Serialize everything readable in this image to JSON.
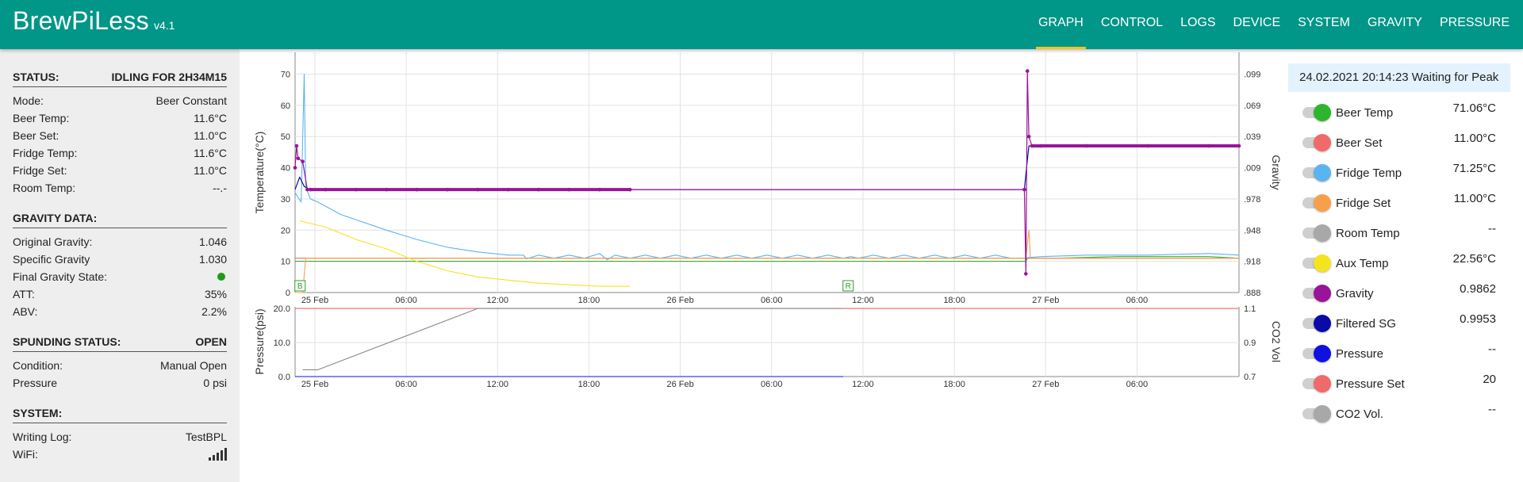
{
  "app": {
    "title": "BrewPiLess",
    "version": "v4.1"
  },
  "nav": [
    {
      "label": "GRAPH",
      "active": true
    },
    {
      "label": "CONTROL"
    },
    {
      "label": "LOGS"
    },
    {
      "label": "DEVICE"
    },
    {
      "label": "SYSTEM"
    },
    {
      "label": "GRAVITY"
    },
    {
      "label": "PRESSURE"
    }
  ],
  "sidebar": {
    "status": {
      "label": "STATUS:",
      "value": "IDLING FOR 2H34M15"
    },
    "status_rows": [
      {
        "label": "Mode:",
        "value": "Beer Constant"
      },
      {
        "label": "Beer Temp:",
        "value": "11.6°C"
      },
      {
        "label": "Beer Set:",
        "value": "11.0°C"
      },
      {
        "label": "Fridge Temp:",
        "value": "11.6°C"
      },
      {
        "label": "Fridge Set:",
        "value": "11.0°C"
      },
      {
        "label": "Room Temp:",
        "value": "--.-"
      }
    ],
    "gravity": {
      "label": "GRAVITY DATA:"
    },
    "gravity_rows": [
      {
        "label": "Original Gravity:",
        "value": "1.046"
      },
      {
        "label": "Specific Gravity",
        "value": "1.030"
      },
      {
        "label": "Final Gravity State:",
        "value": ""
      },
      {
        "label": "ATT:",
        "value": "35%"
      },
      {
        "label": "ABV:",
        "value": "2.2%"
      }
    ],
    "spunding": {
      "label": "SPUNDING STATUS:",
      "value": "OPEN"
    },
    "spunding_rows": [
      {
        "label": "Condition:",
        "value": "Manual Open"
      },
      {
        "label": "Pressure",
        "value": "0 psi"
      }
    ],
    "system": {
      "label": "SYSTEM:"
    },
    "system_rows": [
      {
        "label": "Writing Log:",
        "value": "TestBPL"
      },
      {
        "label": "WiFi:",
        "value": ""
      }
    ]
  },
  "panel": {
    "datetime": "24.02.2021 20:14:23 Waiting for Peak",
    "legend": [
      {
        "name": "Beer Temp",
        "value": "71.06°C",
        "color": "#2db52d"
      },
      {
        "name": "Beer Set",
        "value": "11.00°C",
        "color": "#f06a6a"
      },
      {
        "name": "Fridge Temp",
        "value": "71.25°C",
        "color": "#5ab4f2"
      },
      {
        "name": "Fridge Set",
        "value": "11.00°C",
        "color": "#f7a04b"
      },
      {
        "name": "Room Temp",
        "value": "--",
        "color": "#a8a8a8"
      },
      {
        "name": "Aux Temp",
        "value": "22.56°C",
        "color": "#f4e41e"
      },
      {
        "name": "Gravity",
        "value": "0.9862",
        "color": "#991499"
      },
      {
        "name": "Filtered SG",
        "value": "0.9953",
        "color": "#0a0aa8"
      },
      {
        "name": "Pressure",
        "value": "--",
        "color": "#1010e0"
      },
      {
        "name": "Pressure Set",
        "value": "20",
        "color": "#f06a6a"
      },
      {
        "name": "CO2 Vol.",
        "value": "--",
        "color": "#a8a8a8"
      }
    ]
  },
  "chart_data": [
    {
      "type": "line",
      "ylabel": "Temperature(°C)",
      "y2label": "Gravity",
      "x_tick_labels": [
        "25 Feb",
        "06:00",
        "12:00",
        "18:00",
        "26 Feb",
        "06:00",
        "12:00",
        "18:00",
        "27 Feb",
        "06:00"
      ],
      "y_ticks": [
        "0",
        "10",
        "20",
        "30",
        "40",
        "50",
        "60",
        "70"
      ],
      "y2_ticks": [
        ".888",
        ".918",
        ".948",
        ".978",
        ".009",
        ".039",
        ".069",
        ".099"
      ],
      "ylim": [
        0,
        77
      ],
      "grid": true,
      "annotations": [
        {
          "text": "B",
          "x_hours": 0.3
        },
        {
          "text": "R",
          "x_hours": 36.3
        }
      ],
      "series": [
        {
          "name": "Beer Temp",
          "color": "#2db52d",
          "points": [
            [
              0,
              10
            ],
            [
              0.3,
              10
            ],
            [
              2,
              10
            ],
            [
              4,
              10
            ],
            [
              8,
              10
            ],
            [
              12,
              10
            ],
            [
              16,
              10
            ],
            [
              22,
              10
            ],
            [
              24,
              10
            ],
            [
              28,
              10
            ],
            [
              36,
              10
            ],
            [
              40,
              10
            ],
            [
              48,
              10
            ],
            [
              48.1,
              11
            ],
            [
              50,
              11
            ],
            [
              54,
              11.5
            ],
            [
              60,
              11.5
            ],
            [
              62,
              11
            ]
          ]
        },
        {
          "name": "Beer Set",
          "color": "#f06a6a",
          "points": [
            [
              0,
              11
            ],
            [
              30,
              11
            ],
            [
              36,
              11
            ],
            [
              62,
              11
            ]
          ]
        },
        {
          "name": "Fridge Temp",
          "color": "#5ab4f2",
          "points": [
            [
              0,
              32
            ],
            [
              0.4,
              29
            ],
            [
              0.6,
              70
            ],
            [
              0.7,
              34
            ],
            [
              1,
              30
            ],
            [
              1.5,
              29
            ],
            [
              3,
              25
            ],
            [
              6,
              20
            ],
            [
              8,
              17
            ],
            [
              10,
              14.5
            ],
            [
              12,
              13
            ],
            [
              14,
              12
            ],
            [
              15,
              12
            ],
            [
              15.2,
              10.8
            ],
            [
              16,
              12
            ],
            [
              17,
              11
            ],
            [
              18,
              12
            ],
            [
              19,
              11
            ],
            [
              20,
              12.5
            ],
            [
              20.5,
              10.5
            ],
            [
              21,
              12
            ],
            [
              22,
              11
            ],
            [
              23,
              12
            ],
            [
              24,
              11
            ],
            [
              25,
              12
            ],
            [
              26,
              11
            ],
            [
              27,
              12
            ],
            [
              28,
              11
            ],
            [
              29,
              12
            ],
            [
              30,
              11
            ],
            [
              31,
              12
            ],
            [
              32,
              11
            ],
            [
              33,
              12
            ],
            [
              34,
              11
            ],
            [
              35,
              12
            ],
            [
              36,
              11
            ],
            [
              36.5,
              11.5
            ],
            [
              37,
              11
            ],
            [
              38,
              12
            ],
            [
              39,
              11
            ],
            [
              40,
              12
            ],
            [
              41,
              11
            ],
            [
              42,
              12
            ],
            [
              43,
              11
            ],
            [
              44,
              12
            ],
            [
              45,
              11
            ],
            [
              46,
              12
            ],
            [
              47,
              11
            ],
            [
              48,
              11
            ],
            [
              48.15,
              11.2
            ],
            [
              49,
              11.5
            ],
            [
              52,
              12
            ],
            [
              56,
              12
            ],
            [
              60,
              12.5
            ],
            [
              62,
              12
            ]
          ]
        },
        {
          "name": "Fridge Set",
          "color": "#f7a04b",
          "points": [
            [
              0,
              0
            ],
            [
              0.5,
              0
            ],
            [
              0.7,
              11
            ],
            [
              30,
              11
            ],
            [
              36,
              11
            ],
            [
              48,
              11
            ],
            [
              48.2,
              20
            ],
            [
              48.3,
              11
            ],
            [
              62,
              11
            ]
          ]
        },
        {
          "name": "Aux Temp",
          "color": "#f4e41e",
          "points": [
            [
              0.3,
              23
            ],
            [
              2,
              21
            ],
            [
              4,
              17
            ],
            [
              6,
              14
            ],
            [
              8,
              10
            ],
            [
              10,
              7
            ],
            [
              12,
              5
            ],
            [
              14,
              4
            ],
            [
              16,
              3
            ],
            [
              18,
              2.5
            ],
            [
              20,
              2
            ],
            [
              22,
              2
            ]
          ]
        },
        {
          "name": "Filtered SG",
          "color": "#0a0aa8",
          "points": [
            [
              0,
              33
            ],
            [
              0.3,
              37
            ],
            [
              0.6,
              34
            ],
            [
              1,
              33
            ],
            [
              4,
              33
            ],
            [
              8,
              33
            ],
            [
              12,
              33
            ],
            [
              16,
              33
            ],
            [
              20,
              33
            ],
            [
              24,
              33
            ],
            [
              30,
              33
            ],
            [
              36,
              33
            ],
            [
              40,
              33
            ],
            [
              44,
              33
            ],
            [
              47.9,
              33
            ],
            [
              48,
              38
            ],
            [
              48.2,
              47
            ],
            [
              49,
              47
            ],
            [
              52,
              47
            ],
            [
              56,
              47
            ],
            [
              60,
              47
            ],
            [
              62,
              47
            ]
          ]
        },
        {
          "name": "Gravity",
          "color": "#991499",
          "points": [
            [
              0,
              40
            ],
            [
              0.1,
              47
            ],
            [
              0.2,
              43
            ],
            [
              0.5,
              42
            ],
            [
              0.8,
              33
            ],
            [
              1,
              33
            ],
            [
              2,
              33
            ],
            [
              4,
              33
            ],
            [
              6,
              33
            ],
            [
              8,
              33
            ],
            [
              10,
              33
            ],
            [
              12,
              33
            ],
            [
              14,
              33
            ],
            [
              16,
              33
            ],
            [
              18,
              33
            ],
            [
              20,
              33
            ],
            [
              22,
              33
            ],
            [
              47.9,
              33
            ],
            [
              48,
              6
            ],
            [
              48.1,
              71
            ],
            [
              48.2,
              50
            ],
            [
              48.4,
              47
            ],
            [
              49,
              47
            ],
            [
              52,
              47
            ],
            [
              56,
              47
            ],
            [
              60,
              47
            ],
            [
              62,
              47
            ]
          ]
        }
      ]
    },
    {
      "type": "line",
      "ylabel": "Pressure(psi)",
      "y2label": "CO2 Vol",
      "x_tick_labels": [
        "25 Feb",
        "06:00",
        "12:00",
        "18:00",
        "26 Feb",
        "06:00",
        "12:00",
        "18:00",
        "27 Feb",
        "06:00"
      ],
      "y_ticks": [
        "0.0",
        "10.0",
        "20.0"
      ],
      "y2_ticks": [
        "0.7",
        "0.9",
        "1.1"
      ],
      "ylim": [
        0,
        20.5
      ],
      "series": [
        {
          "name": "Pressure Set",
          "color": "#f06a6a",
          "points": [
            [
              0,
              20
            ],
            [
              62,
              20
            ]
          ]
        },
        {
          "name": "CO2 Vol.",
          "color": "#8a8a8a",
          "points": [
            [
              0.5,
              2
            ],
            [
              1.5,
              2
            ],
            [
              12,
              20
            ],
            [
              36,
              20
            ]
          ]
        },
        {
          "name": "Pressure",
          "color": "#1010e0",
          "points": [
            [
              0,
              0
            ],
            [
              36,
              0
            ]
          ]
        }
      ]
    }
  ]
}
